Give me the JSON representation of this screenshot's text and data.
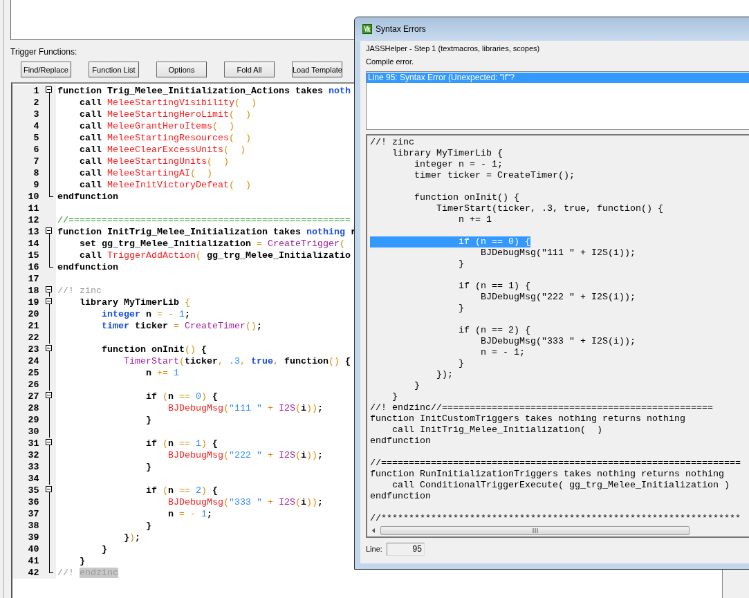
{
  "group_label": "Trigger Functions:",
  "toolbar": [
    "Find/Replace",
    "Function List",
    "Options",
    "Fold All",
    "Load Template"
  ],
  "editor": {
    "lines": [
      {
        "number": "1",
        "kind": "fold-start",
        "tokens": [
          {
            "text": "function Trig_Melee_Initialization_Actions takes ",
            "kind": "plain"
          },
          {
            "text": "noth",
            "kind": "type"
          }
        ]
      },
      {
        "number": "2",
        "kind": "fold-mid",
        "tokens": [
          {
            "text": "    call ",
            "kind": "plain"
          },
          {
            "text": "MeleeStartingVisibility",
            "kind": "bj"
          },
          {
            "text": "(  )",
            "kind": "op"
          }
        ]
      },
      {
        "number": "3",
        "kind": "fold-mid",
        "tokens": [
          {
            "text": "    call ",
            "kind": "plain"
          },
          {
            "text": "MeleeStartingHeroLimit",
            "kind": "bj"
          },
          {
            "text": "(  )",
            "kind": "op"
          }
        ]
      },
      {
        "number": "4",
        "kind": "fold-mid",
        "tokens": [
          {
            "text": "    call ",
            "kind": "plain"
          },
          {
            "text": "MeleeGrantHeroItems",
            "kind": "bj"
          },
          {
            "text": "(  )",
            "kind": "op"
          }
        ]
      },
      {
        "number": "5",
        "kind": "fold-mid",
        "tokens": [
          {
            "text": "    call ",
            "kind": "plain"
          },
          {
            "text": "MeleeStartingResources",
            "kind": "bj"
          },
          {
            "text": "(  )",
            "kind": "op"
          }
        ]
      },
      {
        "number": "6",
        "kind": "fold-mid",
        "tokens": [
          {
            "text": "    call ",
            "kind": "plain"
          },
          {
            "text": "MeleeClearExcessUnits",
            "kind": "bj"
          },
          {
            "text": "(  )",
            "kind": "op"
          }
        ]
      },
      {
        "number": "7",
        "kind": "fold-mid",
        "tokens": [
          {
            "text": "    call ",
            "kind": "plain"
          },
          {
            "text": "MeleeStartingUnits",
            "kind": "bj"
          },
          {
            "text": "(  )",
            "kind": "op"
          }
        ]
      },
      {
        "number": "8",
        "kind": "fold-mid",
        "tokens": [
          {
            "text": "    call ",
            "kind": "plain"
          },
          {
            "text": "MeleeStartingAI",
            "kind": "bj"
          },
          {
            "text": "(  )",
            "kind": "op"
          }
        ]
      },
      {
        "number": "9",
        "kind": "fold-mid",
        "tokens": [
          {
            "text": "    call ",
            "kind": "plain"
          },
          {
            "text": "MeleeInitVictoryDefeat",
            "kind": "bj"
          },
          {
            "text": "(  )",
            "kind": "op"
          }
        ]
      },
      {
        "number": "10",
        "kind": "fold-end",
        "tokens": [
          {
            "text": "endfunction",
            "kind": "plain"
          }
        ]
      },
      {
        "number": "11",
        "kind": "plain"
      },
      {
        "number": "12",
        "kind": "plain",
        "tokens": [
          {
            "text": "//===================================================",
            "kind": "rule"
          }
        ]
      },
      {
        "number": "13",
        "kind": "fold-start",
        "tokens": [
          {
            "text": "function InitTrig_Melee_Initialization takes ",
            "kind": "plain"
          },
          {
            "text": "nothing",
            "kind": "type"
          },
          {
            "text": " r",
            "kind": "plain"
          }
        ]
      },
      {
        "number": "14",
        "kind": "fold-mid",
        "tokens": [
          {
            "text": "    set gg_trg_Melee_Initialization ",
            "kind": "plain"
          },
          {
            "text": "=",
            "kind": "op"
          },
          {
            "text": " CreateTrigger",
            "kind": "native"
          },
          {
            "text": "(",
            "kind": "op"
          }
        ]
      },
      {
        "number": "15",
        "kind": "fold-mid",
        "tokens": [
          {
            "text": "    call ",
            "kind": "plain"
          },
          {
            "text": "TriggerAddAction",
            "kind": "bj"
          },
          {
            "text": "( ",
            "kind": "op"
          },
          {
            "text": "gg_trg_Melee_Initializatio",
            "kind": "plain"
          }
        ]
      },
      {
        "number": "16",
        "kind": "fold-end",
        "tokens": [
          {
            "text": "endfunction",
            "kind": "plain"
          }
        ]
      },
      {
        "number": "17",
        "kind": "plain"
      },
      {
        "number": "18",
        "kind": "fold-start",
        "tokens": [
          {
            "text": "//! zinc",
            "kind": "comment"
          }
        ]
      },
      {
        "number": "19",
        "kind": "fold-start",
        "tokens": [
          {
            "text": "    library MyTimerLib ",
            "kind": "plain"
          },
          {
            "text": "{",
            "kind": "op"
          }
        ]
      },
      {
        "number": "20",
        "kind": "fold-mid",
        "tokens": [
          {
            "text": "        integer",
            "kind": "type"
          },
          {
            "text": " n ",
            "kind": "plain"
          },
          {
            "text": "= -",
            "kind": "op"
          },
          {
            "text": " 1",
            "kind": "num"
          },
          {
            "text": ";",
            "kind": "plain"
          }
        ]
      },
      {
        "number": "21",
        "kind": "fold-mid",
        "tokens": [
          {
            "text": "        timer",
            "kind": "type"
          },
          {
            "text": " ticker ",
            "kind": "plain"
          },
          {
            "text": "=",
            "kind": "op"
          },
          {
            "text": " CreateTimer",
            "kind": "native"
          },
          {
            "text": "()",
            "kind": "op"
          },
          {
            "text": ";",
            "kind": "plain"
          }
        ]
      },
      {
        "number": "22",
        "kind": "fold-mid"
      },
      {
        "number": "23",
        "kind": "fold-start",
        "tokens": [
          {
            "text": "        function onInit",
            "kind": "plain"
          },
          {
            "text": "()",
            "kind": "op"
          },
          {
            "text": " {",
            "kind": "plain"
          }
        ]
      },
      {
        "number": "24",
        "kind": "fold-mid",
        "tokens": [
          {
            "text": "            TimerStart",
            "kind": "native"
          },
          {
            "text": "(",
            "kind": "op"
          },
          {
            "text": "ticker",
            "kind": "plain"
          },
          {
            "text": ", ",
            "kind": "op"
          },
          {
            "text": ".3",
            "kind": "num"
          },
          {
            "text": ", ",
            "kind": "op"
          },
          {
            "text": "true",
            "kind": "type"
          },
          {
            "text": ", ",
            "kind": "op"
          },
          {
            "text": "function",
            "kind": "plain"
          },
          {
            "text": "()",
            "kind": "op"
          },
          {
            "text": " {",
            "kind": "plain"
          }
        ]
      },
      {
        "number": "25",
        "kind": "fold-mid",
        "tokens": [
          {
            "text": "                n ",
            "kind": "plain"
          },
          {
            "text": "+=",
            "kind": "op"
          },
          {
            "text": " 1",
            "kind": "num"
          }
        ]
      },
      {
        "number": "26",
        "kind": "fold-mid"
      },
      {
        "number": "27",
        "kind": "fold-start",
        "tokens": [
          {
            "text": "                if ",
            "kind": "plain"
          },
          {
            "text": "(",
            "kind": "op"
          },
          {
            "text": "n ",
            "kind": "plain"
          },
          {
            "text": "==",
            "kind": "op"
          },
          {
            "text": " 0",
            "kind": "num"
          },
          {
            "text": ")",
            "kind": "op"
          },
          {
            "text": " {",
            "kind": "plain"
          }
        ]
      },
      {
        "number": "28",
        "kind": "fold-mid",
        "tokens": [
          {
            "text": "                    BJDebugMsg",
            "kind": "bj"
          },
          {
            "text": "(",
            "kind": "op"
          },
          {
            "text": "\"111 \"",
            "kind": "str"
          },
          {
            "text": " + ",
            "kind": "op"
          },
          {
            "text": "I2S",
            "kind": "native"
          },
          {
            "text": "(",
            "kind": "op"
          },
          {
            "text": "i",
            "kind": "plain"
          },
          {
            "text": "))",
            "kind": "op"
          },
          {
            "text": ";",
            "kind": "plain"
          }
        ]
      },
      {
        "number": "29",
        "kind": "fold-mid",
        "tokens": [
          {
            "text": "                }",
            "kind": "plain"
          }
        ]
      },
      {
        "number": "30",
        "kind": "fold-mid"
      },
      {
        "number": "31",
        "kind": "fold-start",
        "tokens": [
          {
            "text": "                if ",
            "kind": "plain"
          },
          {
            "text": "(",
            "kind": "op"
          },
          {
            "text": "n ",
            "kind": "plain"
          },
          {
            "text": "==",
            "kind": "op"
          },
          {
            "text": " 1",
            "kind": "num"
          },
          {
            "text": ")",
            "kind": "op"
          },
          {
            "text": " {",
            "kind": "plain"
          }
        ]
      },
      {
        "number": "32",
        "kind": "fold-mid",
        "tokens": [
          {
            "text": "                    BJDebugMsg",
            "kind": "bj"
          },
          {
            "text": "(",
            "kind": "op"
          },
          {
            "text": "\"222 \"",
            "kind": "str"
          },
          {
            "text": " + ",
            "kind": "op"
          },
          {
            "text": "I2S",
            "kind": "native"
          },
          {
            "text": "(",
            "kind": "op"
          },
          {
            "text": "i",
            "kind": "plain"
          },
          {
            "text": "))",
            "kind": "op"
          },
          {
            "text": ";",
            "kind": "plain"
          }
        ]
      },
      {
        "number": "33",
        "kind": "fold-mid",
        "tokens": [
          {
            "text": "                }",
            "kind": "plain"
          }
        ]
      },
      {
        "number": "34",
        "kind": "fold-mid"
      },
      {
        "number": "35",
        "kind": "fold-start",
        "tokens": [
          {
            "text": "                if ",
            "kind": "plain"
          },
          {
            "text": "(",
            "kind": "op"
          },
          {
            "text": "n ",
            "kind": "plain"
          },
          {
            "text": "==",
            "kind": "op"
          },
          {
            "text": " 2",
            "kind": "num"
          },
          {
            "text": ")",
            "kind": "op"
          },
          {
            "text": " {",
            "kind": "plain"
          }
        ]
      },
      {
        "number": "36",
        "kind": "fold-mid",
        "tokens": [
          {
            "text": "                    BJDebugMsg",
            "kind": "bj"
          },
          {
            "text": "(",
            "kind": "op"
          },
          {
            "text": "\"333 \"",
            "kind": "str"
          },
          {
            "text": " + ",
            "kind": "op"
          },
          {
            "text": "I2S",
            "kind": "native"
          },
          {
            "text": "(",
            "kind": "op"
          },
          {
            "text": "i",
            "kind": "plain"
          },
          {
            "text": "))",
            "kind": "op"
          },
          {
            "text": ";",
            "kind": "plain"
          }
        ]
      },
      {
        "number": "37",
        "kind": "fold-mid",
        "tokens": [
          {
            "text": "                    n ",
            "kind": "plain"
          },
          {
            "text": "= -",
            "kind": "op"
          },
          {
            "text": " 1",
            "kind": "num"
          },
          {
            "text": ";",
            "kind": "plain"
          }
        ]
      },
      {
        "number": "38",
        "kind": "fold-mid",
        "tokens": [
          {
            "text": "                }",
            "kind": "plain"
          }
        ]
      },
      {
        "number": "39",
        "kind": "fold-mid",
        "tokens": [
          {
            "text": "            }",
            "kind": "plain"
          },
          {
            "text": ")",
            "kind": "op"
          },
          {
            "text": ";",
            "kind": "plain"
          }
        ]
      },
      {
        "number": "40",
        "kind": "fold-mid",
        "tokens": [
          {
            "text": "        }",
            "kind": "plain"
          }
        ]
      },
      {
        "number": "41",
        "kind": "fold-mid",
        "tokens": [
          {
            "text": "    }",
            "kind": "plain"
          }
        ]
      },
      {
        "number": "42",
        "kind": "fold-end",
        "tokens": [
          {
            "text": "//! ",
            "kind": "comment"
          },
          {
            "text": "endzinc",
            "kind": "match"
          }
        ]
      }
    ]
  },
  "dialog": {
    "title": "Syntax Errors",
    "step": "JASSHelper - Step 1 (textmacros, libraries, scopes)",
    "status": "Compile error.",
    "errors": [
      {
        "text": "Line 95: Syntax Error (Unexpected: \"if\"?",
        "selected": true
      }
    ],
    "code_lines": [
      {
        "text": "//! zinc",
        "selected": false
      },
      {
        "text": "    library MyTimerLib {",
        "selected": false
      },
      {
        "text": "        integer n = - 1;",
        "selected": false
      },
      {
        "text": "        timer ticker = CreateTimer();",
        "selected": false
      },
      {
        "selected": false
      },
      {
        "text": "        function onInit() {",
        "selected": false
      },
      {
        "text": "            TimerStart(ticker, .3, true, function() {",
        "selected": false
      },
      {
        "text": "                n += 1",
        "selected": false
      },
      {
        "selected": false
      },
      {
        "text": "                if (n == 0) {",
        "selected": true
      },
      {
        "text": "                    BJDebugMsg(\"111 \" + I2S(i));",
        "selected": false
      },
      {
        "text": "                }",
        "selected": false
      },
      {
        "selected": false
      },
      {
        "text": "                if (n == 1) {",
        "selected": false
      },
      {
        "text": "                    BJDebugMsg(\"222 \" + I2S(i));",
        "selected": false
      },
      {
        "text": "                }",
        "selected": false
      },
      {
        "selected": false
      },
      {
        "text": "                if (n == 2) {",
        "selected": false
      },
      {
        "text": "                    BJDebugMsg(\"333 \" + I2S(i));",
        "selected": false
      },
      {
        "text": "                    n = - 1;",
        "selected": false
      },
      {
        "text": "                }",
        "selected": false
      },
      {
        "text": "            });",
        "selected": false
      },
      {
        "text": "        }",
        "selected": false
      },
      {
        "text": "    }",
        "selected": false
      },
      {
        "text": "//! endzinc//=================================================",
        "selected": false
      },
      {
        "text": "function InitCustomTriggers takes nothing returns nothing",
        "selected": false
      },
      {
        "text": "    call InitTrig_Melee_Initialization(  )",
        "selected": false
      },
      {
        "text": "endfunction",
        "selected": false
      },
      {
        "selected": false
      },
      {
        "text": "//=================================================================",
        "selected": false
      },
      {
        "text": "function RunInitializationTriggers takes nothing returns nothing",
        "selected": false
      },
      {
        "text": "    call ConditionalTriggerExecute( gg_trg_Melee_Initialization )",
        "selected": false
      },
      {
        "text": "endfunction",
        "selected": false
      },
      {
        "selected": false
      },
      {
        "text": "//*****************************************************************",
        "selected": false
      }
    ],
    "line_label": "Line:",
    "line_value": "95"
  }
}
